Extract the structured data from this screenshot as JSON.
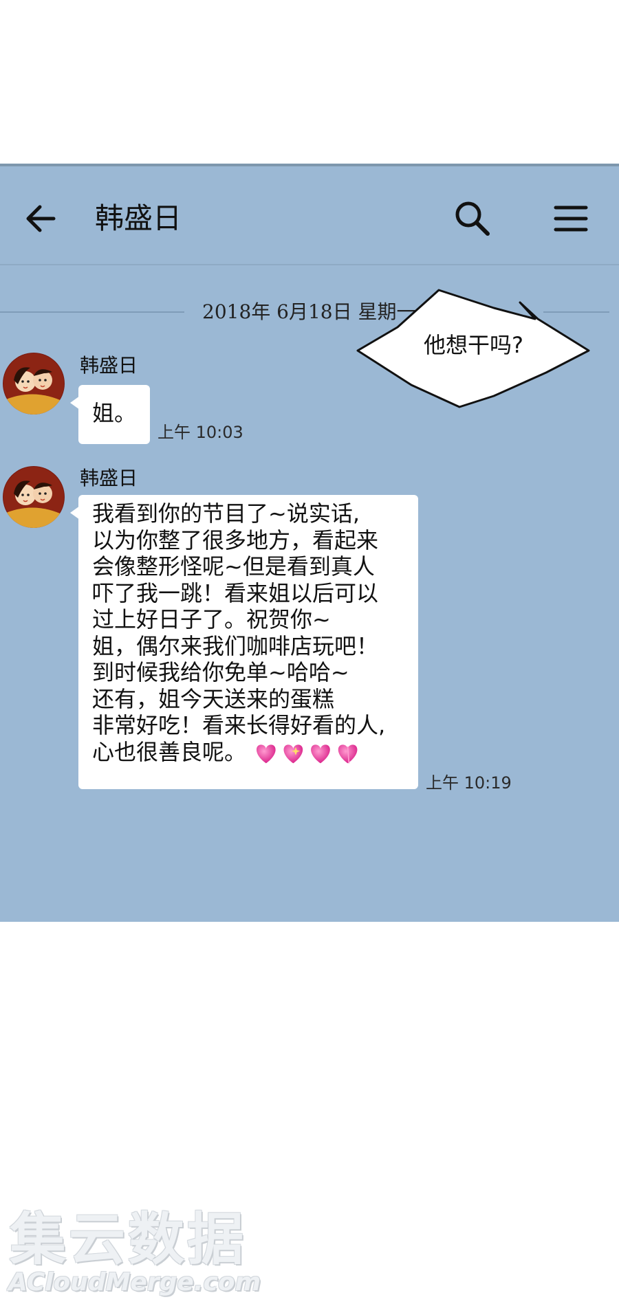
{
  "header": {
    "back_icon": "arrow-left-icon",
    "title": "韩盛日",
    "search_icon": "search-icon",
    "menu_icon": "hamburger-menu-icon"
  },
  "date_separator": "2018年 6月18日 星期一",
  "messages": [
    {
      "sender": "韩盛日",
      "lines": [
        "姐。"
      ],
      "time": "上午 10:03"
    },
    {
      "sender": "韩盛日",
      "lines": [
        "我看到你的节目了~说实话,",
        "以为你整了很多地方，看起来",
        "会像整形怪呢~但是看到真人",
        "吓了我一跳！看来姐以后可以",
        "过上好日子了。祝贺你~",
        "姐，偶尔来我们咖啡店玩吧！",
        "到时候我给你免单~哈哈~",
        "还有，姐今天送来的蛋糕",
        "非常好吃！看来长得好看的人,",
        "心也很善良呢。"
      ],
      "emoji": "four-pink-hearts",
      "time": "上午 10:19"
    }
  ],
  "speech_bubble": "他想干吗?",
  "watermark": {
    "cn": "集云数据",
    "en": "ACloudMerge.com"
  },
  "colors": {
    "chat_background": "#9bb8d4",
    "bubble": "#ffffff",
    "heart": "#e8389a"
  }
}
